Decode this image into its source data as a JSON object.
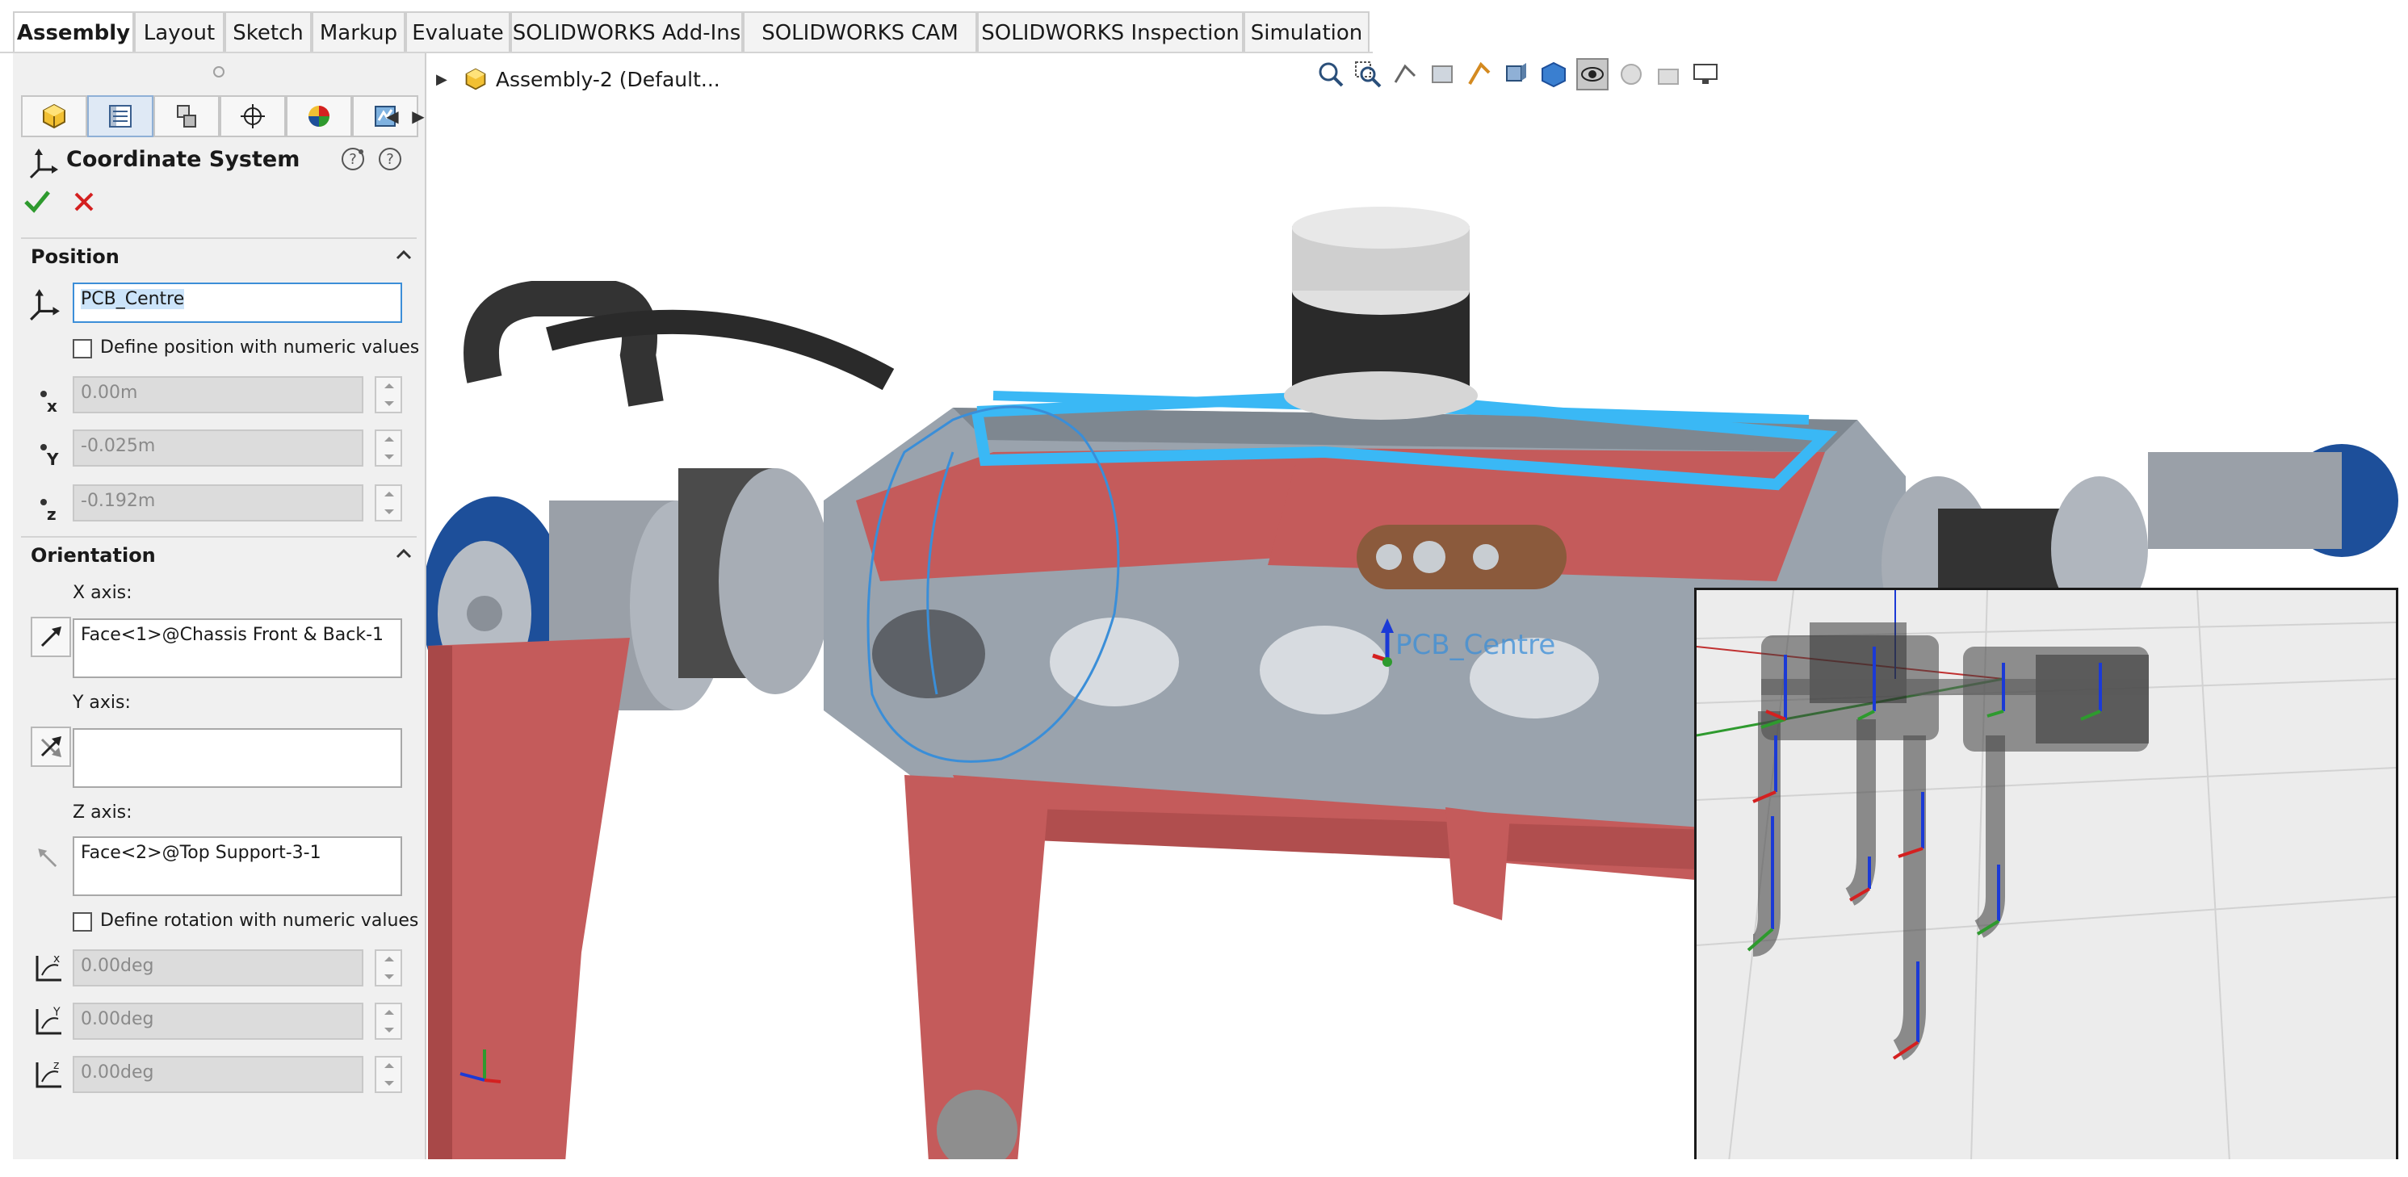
{
  "ribbon": {
    "tabs": [
      {
        "label": "Assembly",
        "active": true
      },
      {
        "label": "Layout"
      },
      {
        "label": "Sketch"
      },
      {
        "label": "Markup"
      },
      {
        "label": "Evaluate"
      },
      {
        "label": "SOLIDWORKS Add-Ins"
      },
      {
        "label": "SOLIDWORKS CAM"
      },
      {
        "label": "SOLIDWORKS Inspection"
      },
      {
        "label": "Simulation"
      }
    ]
  },
  "tree": {
    "root_label": "Assembly-2  (Default..."
  },
  "property_manager": {
    "title": "Coordinate System",
    "position": {
      "section_title": "Position",
      "origin_value": "PCB_Centre",
      "numeric_checkbox_label": "Define position with numeric values",
      "x_value": "0.00m",
      "y_value": "-0.025m",
      "z_value": "-0.192m"
    },
    "orientation": {
      "section_title": "Orientation",
      "x_axis_label": "X axis:",
      "x_axis_value": "Face<1>@Chassis Front & Back-1",
      "y_axis_label": "Y axis:",
      "y_axis_value": "",
      "z_axis_label": "Z axis:",
      "z_axis_value": "Face<2>@Top Support-3-1",
      "numeric_checkbox_label": "Define rotation with numeric values",
      "rx_value": "0.00deg",
      "ry_value": "0.00deg",
      "rz_value": "0.00deg"
    }
  },
  "viewport": {
    "coordinate_system_label": "PCB_Centre"
  },
  "axis_letters": {
    "x": "x",
    "y": "Y",
    "z": "z"
  },
  "colors": {
    "chassis_red": "#c45b5b",
    "frame_gray": "#9aa3ad",
    "highlight_blue": "#3ab8f5",
    "motor_blue": "#1d4f9a",
    "ok_green": "#2e9a2e",
    "cancel_red": "#d42020"
  }
}
